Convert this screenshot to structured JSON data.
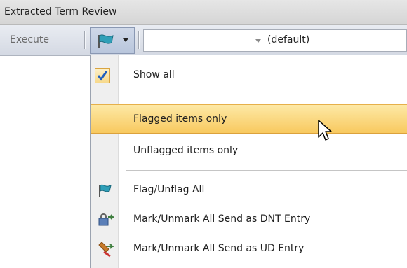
{
  "window": {
    "title": "Extracted Term Review"
  },
  "toolbar": {
    "execute_label": "Execute",
    "flag_filter_icon": "flag-filter-icon",
    "combo_value": "(default)"
  },
  "menu": {
    "items": [
      {
        "label": "Show all",
        "checked": true,
        "icon": "checkmark-icon"
      },
      {
        "label": "Flagged items only",
        "highlighted": true
      },
      {
        "label": "Unflagged items only"
      },
      {
        "label": "Flag/Unflag All",
        "icon": "flag-icon"
      },
      {
        "label": "Mark/Unmark All Send as DNT Entry",
        "icon": "dnt-entry-icon"
      },
      {
        "label": "Mark/Unmark All Send as UD Entry",
        "icon": "ud-entry-icon"
      }
    ]
  },
  "colors": {
    "highlight": "#f8c95f",
    "check": "#1f5fbf",
    "flag": "#2f9fb8"
  }
}
